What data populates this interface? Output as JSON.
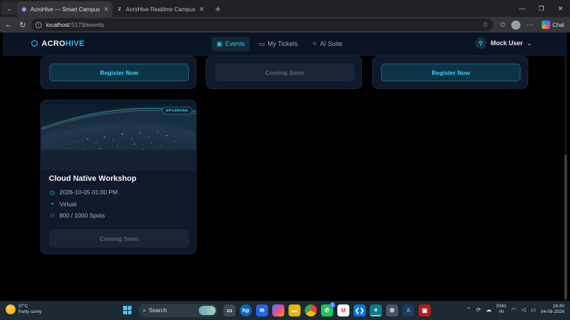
{
  "browser": {
    "tabs": [
      {
        "title": "AcroHive — Smart Campus Events",
        "active": true
      },
      {
        "title": "AcroHive Realtime Campus OS - E",
        "active": false
      }
    ],
    "new_tab": "+",
    "url_host": "localhost",
    "url_path": ":5173/events",
    "chat_label": "Chat"
  },
  "app": {
    "brand_a": "ACRO",
    "brand_b": "HIVE",
    "nav": [
      {
        "label": "Events",
        "icon": "calendar-icon",
        "active": true
      },
      {
        "label": "My Tickets",
        "icon": "ticket-icon",
        "active": false
      },
      {
        "label": "AI Suite",
        "icon": "sparkles-icon",
        "active": false
      }
    ],
    "user_name": "Mock User"
  },
  "cards_top": [
    {
      "button": "Register Now",
      "state": "register"
    },
    {
      "button": "Coming Soon",
      "state": "disabled"
    },
    {
      "button": "Register Now",
      "state": "register"
    }
  ],
  "event": {
    "badge": "UPCOMING",
    "title": "Cloud Native Workshop",
    "datetime": "2026-10-05 01:00 PM",
    "location": "Virtual",
    "spots": "800 / 1000 Spots",
    "button": "Coming Soon"
  },
  "taskbar": {
    "temp": "37°C",
    "condition": "Partly sunny",
    "search": "Search",
    "lang_1": "ENG",
    "lang_2": "IN",
    "time": "16:40",
    "date": "04-06-2026",
    "notification_count": "1"
  },
  "colors": {
    "accent": "#22c3ee",
    "nav_bg": "#0b1424",
    "card_bg": "#101a2b"
  }
}
